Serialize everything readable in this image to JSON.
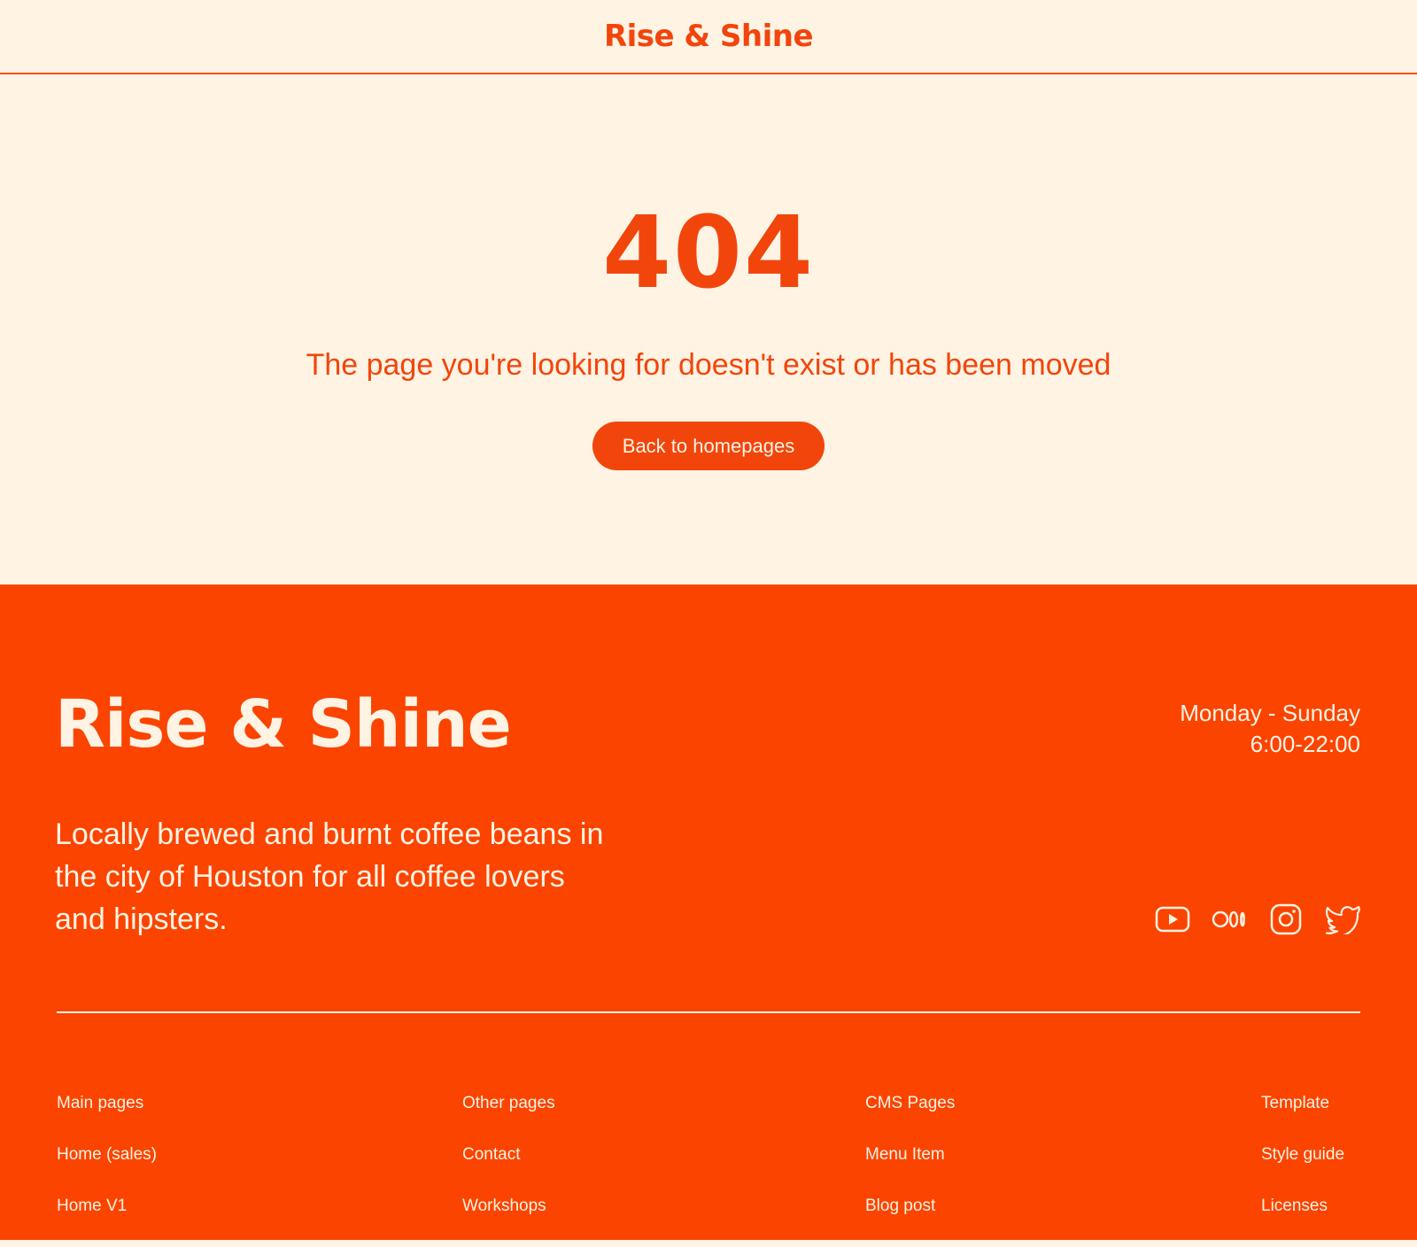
{
  "header": {
    "brand": "Rise & Shine"
  },
  "error": {
    "code": "404",
    "message": "The page you're looking for doesn't exist or has been moved",
    "button_label": "Back to homepages"
  },
  "footer": {
    "brand": "Rise & Shine",
    "hours_days": "Monday - Sunday",
    "hours_time": "6:00-22:00",
    "tagline": "Locally brewed and burnt coffee beans in the city of Houston for all coffee lovers and hipsters.",
    "socials": [
      {
        "icon": "youtube-icon"
      },
      {
        "icon": "medium-icon"
      },
      {
        "icon": "instagram-icon"
      },
      {
        "icon": "twitter-icon"
      }
    ],
    "columns": [
      {
        "title": "Main pages",
        "links": [
          "Home (sales)",
          "Home V1"
        ]
      },
      {
        "title": "Other pages",
        "links": [
          "Contact",
          "Workshops"
        ]
      },
      {
        "title": "CMS Pages",
        "links": [
          "Menu Item",
          "Blog post"
        ]
      },
      {
        "title": "Template",
        "links": [
          "Style guide",
          "Licenses"
        ]
      }
    ]
  },
  "colors": {
    "accent": "#f2450c",
    "footer_bg": "#fb4400",
    "cream": "#fff3e3"
  }
}
